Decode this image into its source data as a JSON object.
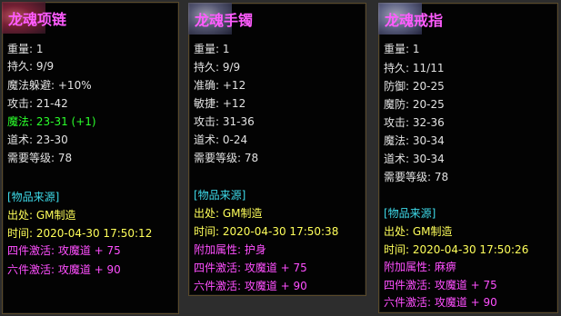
{
  "items": [
    {
      "title": "龙魂项链",
      "stats": [
        {
          "label": "重量:",
          "value": "1",
          "color": "white"
        },
        {
          "label": "持久:",
          "value": "9/9",
          "color": "white"
        },
        {
          "label": "魔法躲避:",
          "value": "+10%",
          "color": "white"
        },
        {
          "label": "攻击:",
          "value": "21-42",
          "color": "white"
        },
        {
          "label": "魔法:",
          "value": "23-31 (+1)",
          "color": "green"
        },
        {
          "label": "道术:",
          "value": "23-30",
          "color": "white"
        },
        {
          "label": "需要等级:",
          "value": "78",
          "color": "white"
        }
      ],
      "source_header": "[物品来源]",
      "origin": {
        "label": "出处:",
        "value": "GM制造"
      },
      "time": {
        "label": "时间:",
        "value": "2020-04-30 17:50:12"
      },
      "extra": [
        {
          "text": "四件激活: 攻魔道 + 75",
          "color": "magenta"
        },
        {
          "text": "六件激活: 攻魔道 + 90",
          "color": "magenta"
        }
      ]
    },
    {
      "title": "龙魂手镯",
      "stats": [
        {
          "label": "重量:",
          "value": "1",
          "color": "white"
        },
        {
          "label": "持久:",
          "value": "9/9",
          "color": "white"
        },
        {
          "label": "准确:",
          "value": "+12",
          "color": "white"
        },
        {
          "label": "敏捷:",
          "value": "+12",
          "color": "white"
        },
        {
          "label": "攻击:",
          "value": "31-36",
          "color": "white"
        },
        {
          "label": "道术:",
          "value": "0-24",
          "color": "white"
        },
        {
          "label": "需要等级:",
          "value": "78",
          "color": "white"
        }
      ],
      "source_header": "[物品来源]",
      "origin": {
        "label": "出处:",
        "value": "GM制造"
      },
      "time": {
        "label": "时间:",
        "value": "2020-04-30 17:50:38"
      },
      "extra": [
        {
          "text": "附加属性: 护身",
          "color": "magenta"
        },
        {
          "text": "四件激活: 攻魔道 + 75",
          "color": "magenta"
        },
        {
          "text": "六件激活: 攻魔道 + 90",
          "color": "magenta"
        }
      ]
    },
    {
      "title": "龙魂戒指",
      "stats": [
        {
          "label": "重量:",
          "value": "1",
          "color": "white"
        },
        {
          "label": "持久:",
          "value": "11/11",
          "color": "white"
        },
        {
          "label": "防御:",
          "value": "20-25",
          "color": "white"
        },
        {
          "label": "魔防:",
          "value": "20-25",
          "color": "white"
        },
        {
          "label": "攻击:",
          "value": "32-36",
          "color": "white"
        },
        {
          "label": "魔法:",
          "value": "30-34",
          "color": "white"
        },
        {
          "label": "道术:",
          "value": "30-34",
          "color": "white"
        },
        {
          "label": "需要等级:",
          "value": "78",
          "color": "white"
        }
      ],
      "source_header": "[物品来源]",
      "origin": {
        "label": "出处:",
        "value": "GM制造"
      },
      "time": {
        "label": "时间:",
        "value": "2020-04-30 17:50:26"
      },
      "extra": [
        {
          "text": "附加属性: 麻痹",
          "color": "magenta"
        },
        {
          "text": "四件激活: 攻魔道 + 75",
          "color": "magenta"
        },
        {
          "text": "六件激活: 攻魔道 + 90",
          "color": "magenta"
        }
      ]
    }
  ]
}
